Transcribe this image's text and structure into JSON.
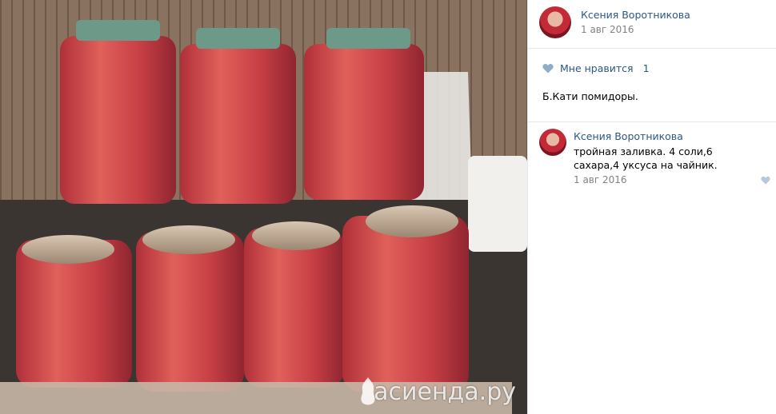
{
  "post": {
    "author": "Ксения Воротникова",
    "date": "1 авг 2016",
    "likes_label": "Мне нравится",
    "likes_count": "1",
    "caption": "Б.Кати помидоры."
  },
  "comment": {
    "author": "Ксения Воротникова",
    "text": "тройная заливка. 4 соли,6 сахара,4 уксуса на чайник.",
    "date": "1 авг 2016"
  },
  "watermark": "асиенда.ру",
  "colors": {
    "link": "#2a5885",
    "muted": "#828282",
    "like_heart": "#8fadc8"
  },
  "icons": [
    "heart-icon",
    "heart-icon-small",
    "violin-icon"
  ]
}
